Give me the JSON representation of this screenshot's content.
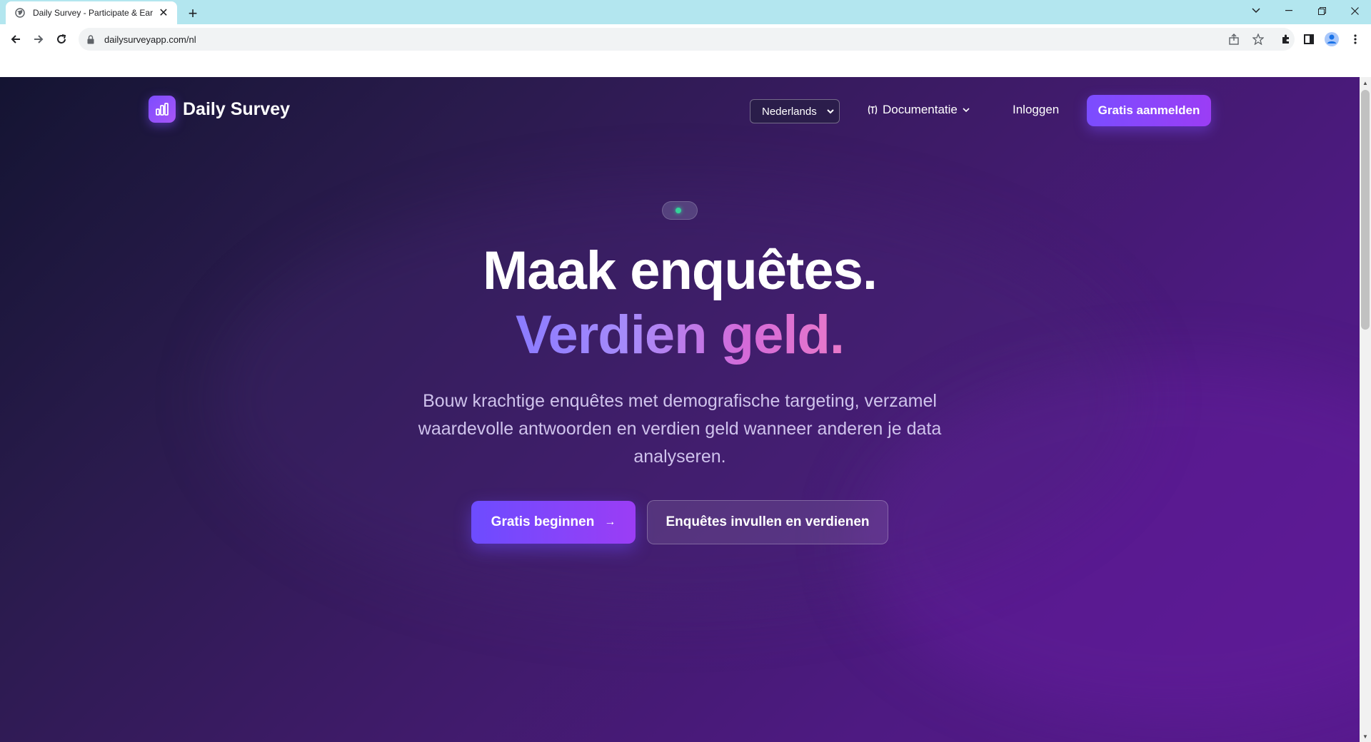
{
  "browser": {
    "tab_title": "Daily Survey - Participate & Earn",
    "url": "dailysurveyapp.com/nl"
  },
  "header": {
    "logo_text": "Daily Survey",
    "language_selected": "Nederlands",
    "docs_label": "Documentatie",
    "login_label": "Inloggen",
    "signup_label": "Gratis aanmelden"
  },
  "hero": {
    "title_line1": "Maak enquêtes.",
    "title_line2": "Verdien geld.",
    "subtitle": "Bouw krachtige enquêtes met demografische targeting, verzamel waardevolle antwoorden en verdien geld wanneer anderen je data analyseren.",
    "primary_cta": "Gratis beginnen",
    "primary_cta_arrow": "→",
    "secondary_cta": "Enquêtes invullen en verdienen"
  },
  "colors": {
    "accent": "#7b4dff",
    "status_dot": "#34d399",
    "tabstrip": "#b3e6ef"
  },
  "icons": {
    "logo": "bar-chart-icon",
    "docs": "book-icon",
    "status": "status-dot"
  }
}
